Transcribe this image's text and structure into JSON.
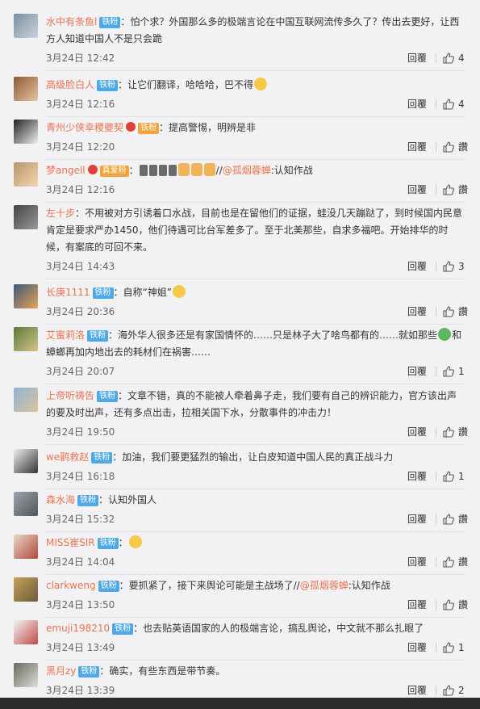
{
  "reply_label": "回覆",
  "like_placeholder": "讚",
  "comments": [
    {
      "user": "水中有条鱼l",
      "badge": "铁粉",
      "segments": [
        {
          "t": "：怕个求？外国那么多的极端言论在中国互联网流传多久了？传出去更好，让西方人知道中国人不是只会跪"
        }
      ],
      "time": "3月24日 12:42",
      "likes": "4",
      "avatar": [
        "#7a8fa3",
        "#c9d3dd"
      ]
    },
    {
      "user": "高级脸白人",
      "badge": "铁粉",
      "segments": [
        {
          "t": "：让它们翻译，哈哈哈，巴不得"
        },
        {
          "e": "emoji"
        }
      ],
      "time": "3月24日 12:16",
      "likes": "4",
      "avatar": [
        "#8a5a3a",
        "#e8c4a0"
      ]
    },
    {
      "user": "青州少侠幸稷夔契",
      "badge": "铁粉",
      "badge_style": "gold",
      "segments": [
        {
          "t": "：提高警惕，明辨是非"
        }
      ],
      "time": "3月24日 12:20",
      "likes": "讚",
      "avatar": [
        "#222",
        "#eee"
      ]
    },
    {
      "user": "梦angell",
      "badge": "真爱粉",
      "badge_style": "gold",
      "segments": [
        {
          "t": "："
        },
        {
          "e": "box"
        },
        {
          "e": "box"
        },
        {
          "e": "box"
        },
        {
          "e": "box"
        },
        {
          "e": "fist"
        },
        {
          "e": "fist"
        },
        {
          "e": "fist"
        },
        {
          "t": "//"
        },
        {
          "m": "@孤烟蓉蝉"
        },
        {
          "t": ":认知作战"
        }
      ],
      "time": "3月24日 12:16",
      "likes": "讚",
      "avatar": [
        "#b8946a",
        "#f1d7b2"
      ]
    },
    {
      "user": "左十步",
      "badge": "",
      "segments": [
        {
          "t": "：不用被对方引诱着口水战，目前也是在留他们的证据，蛙没几天蹦跶了，到时候国内民意肯定是要求严办1450，他们待遇可比台军差多了。至于北美那些，自求多福吧。开始排华的时候，有案底的可回不来。"
        }
      ],
      "time": "3月24日 14:43",
      "likes": "3",
      "avatar": [
        "#444",
        "#999"
      ]
    },
    {
      "user": "长庚1111",
      "badge": "铁粉",
      "segments": [
        {
          "t": "：自称“神姐”"
        },
        {
          "e": "emoji"
        }
      ],
      "time": "3月24日 20:36",
      "likes": "讚",
      "avatar": [
        "#3a5a7a",
        "#e7a35a"
      ]
    },
    {
      "user": "艾蜜莉洛",
      "badge": "铁粉",
      "segments": [
        {
          "t": "：海外华人很多还是有家国情怀的……只是林子大了啥鸟都有的……就如那些"
        },
        {
          "e": "frog"
        },
        {
          "t": "和蟑螂再加内地出去的耗材们在祸害……"
        }
      ],
      "time": "3月24日 20:07",
      "likes": "1",
      "avatar": [
        "#5a7a3a",
        "#d6c38a"
      ]
    },
    {
      "user": "上帝听祷告",
      "badge": "铁粉",
      "segments": [
        {
          "t": "：文章不错，真的不能被人牵着鼻子走，我们要有自己的辨识能力，官方该出声的要及时出声，还有多点出击，拉相关国下水，分散事件的冲击力！"
        }
      ],
      "time": "3月24日 19:50",
      "likes": "讚",
      "avatar": [
        "#8fb3d6",
        "#d9c49a"
      ]
    },
    {
      "user": "we鹳救赵",
      "badge": "铁粉",
      "segments": [
        {
          "t": "：加油，我们要更猛烈的输出，让白皮知道中国人民的真正战斗力"
        }
      ],
      "time": "3月24日 16:18",
      "likes": "1",
      "avatar": [
        "#eee",
        "#333"
      ]
    },
    {
      "user": "森水海",
      "badge": "铁粉",
      "segments": [
        {
          "t": "：认知外国人"
        }
      ],
      "time": "3月24日 15:32",
      "likes": "讚",
      "avatar": [
        "#9aa3ad",
        "#555"
      ]
    },
    {
      "user": "MISS崔SIR",
      "badge": "铁粉",
      "segments": [
        {
          "t": "："
        },
        {
          "e": "emoji"
        }
      ],
      "time": "3月24日 14:04",
      "likes": "讚",
      "avatar": [
        "#e8d7c4",
        "#b04a3a"
      ]
    },
    {
      "user": "clarkweng",
      "badge": "铁粉",
      "segments": [
        {
          "t": "：要抓紧了，接下来舆论可能是主战场了//"
        },
        {
          "m": "@孤烟蓉蝉"
        },
        {
          "t": ":认知作战"
        }
      ],
      "time": "3月24日 13:50",
      "likes": "讚",
      "avatar": [
        "#c9a25a",
        "#6a5a3a"
      ]
    },
    {
      "user": "emuji198210",
      "badge": "铁粉",
      "segments": [
        {
          "t": "：也去贴英语国家的人的极端言论，搞乱舆论，中文就不那么扎眼了"
        }
      ],
      "time": "3月24日 13:49",
      "likes": "1",
      "avatar": [
        "#f3f3f3",
        "#c04a4a"
      ]
    },
    {
      "user": "黑月zy",
      "badge": "铁粉",
      "segments": [
        {
          "t": "：确实，有些东西是带节奏。"
        }
      ],
      "time": "3月24日 13:39",
      "likes": "2",
      "avatar": [
        "#6a6a5a",
        "#ddd"
      ]
    }
  ]
}
